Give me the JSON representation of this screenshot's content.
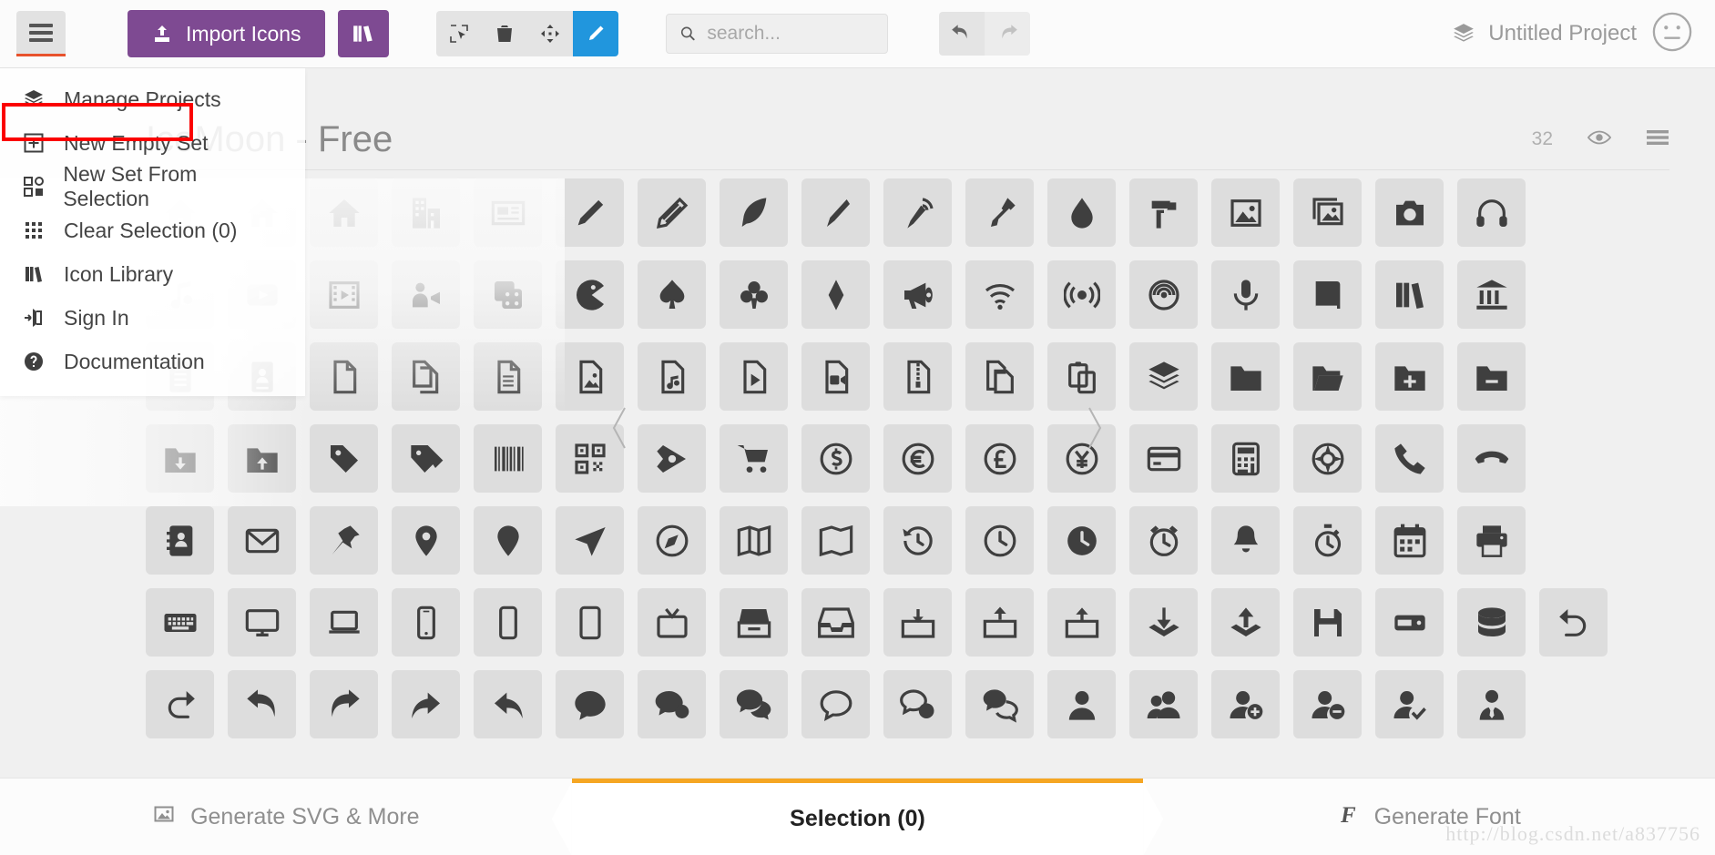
{
  "toolbar": {
    "menu_button_icon": "hamburger-icon",
    "import_label": "Import Icons",
    "import_icon": "upload-icon",
    "library_icon": "books-icon",
    "tools": [
      {
        "name": "select-tool",
        "icon": "cursor-select-icon",
        "active": false
      },
      {
        "name": "delete-tool",
        "icon": "trash-icon",
        "active": false
      },
      {
        "name": "move-tool",
        "icon": "move-arrows-icon",
        "active": false
      },
      {
        "name": "edit-tool",
        "icon": "pencil-icon",
        "active": true
      }
    ],
    "search": {
      "value": "",
      "placeholder": "search...",
      "icon": "search-icon"
    },
    "undo": {
      "icon": "undo-arrow-icon",
      "enabled": true
    },
    "redo": {
      "icon": "redo-arrow-icon",
      "enabled": false
    },
    "project_name": "Untitled Project",
    "project_icon": "stack-icon",
    "avatar_icon": "neutral-face-icon"
  },
  "menu": {
    "items": [
      {
        "label": "Manage Projects",
        "icon": "stack-icon",
        "highlighted": false
      },
      {
        "label": "New Empty Set",
        "icon": "plus-square-icon",
        "highlighted": true
      },
      {
        "label": "New Set From Selection",
        "icon": "new-set-icon",
        "highlighted": false
      },
      {
        "label": "Clear Selection (0)",
        "icon": "grid-dots-icon",
        "highlighted": false
      },
      {
        "label": "Icon Library",
        "icon": "books-icon",
        "highlighted": false
      },
      {
        "label": "Sign In",
        "icon": "sign-in-icon",
        "highlighted": false
      },
      {
        "label": "Documentation",
        "icon": "question-circle-icon",
        "highlighted": false
      }
    ],
    "highlight_color": "#fb0000"
  },
  "set": {
    "title": "IcoMoon - Free",
    "count": "32",
    "visibility_icon": "eye-icon",
    "menu_icon": "hamburger-icon"
  },
  "grid": {
    "rows": [
      [
        "home",
        "home2",
        "home3",
        "office",
        "newspaper",
        "pencil",
        "pencil2",
        "quill",
        "pen",
        "blog",
        "eyedropper",
        "droplet",
        "paint-format",
        "image",
        "images",
        "camera",
        "headphones"
      ],
      [
        "music",
        "play",
        "film",
        "video-camera",
        "dice",
        "pacman",
        "spades",
        "clubs",
        "diamonds",
        "bullhorn",
        "connection",
        "podcast",
        "feed",
        "mic",
        "book",
        "books",
        "library"
      ],
      [
        "file-text2",
        "profile",
        "file-empty",
        "files-empty",
        "file-text",
        "file-picture",
        "file-music",
        "file-play",
        "file-video",
        "file-zip",
        "copy",
        "paste",
        "stack",
        "folder",
        "folder-open",
        "folder-plus",
        "folder-minus"
      ],
      [
        "folder-download",
        "folder-upload",
        "price-tag",
        "price-tags",
        "barcode",
        "qrcode",
        "ticket",
        "cart",
        "coin-dollar",
        "coin-euro",
        "coin-pound",
        "coin-yen",
        "credit-card",
        "calculator",
        "lifebuoy",
        "phone",
        "phone-hang-up"
      ],
      [
        "address-book",
        "envelop",
        "pushpin",
        "location",
        "location2",
        "compass",
        "compass2",
        "map",
        "map2",
        "history",
        "clock",
        "clock2",
        "alarm",
        "bell",
        "stopwatch",
        "calendar",
        "printer"
      ],
      [
        "keyboard",
        "display",
        "laptop",
        "mobile",
        "mobile2",
        "tablet",
        "tv",
        "drawer",
        "drawer2",
        "drawer3",
        "box-add",
        "box-remove",
        "download",
        "upload",
        "floppy-disk",
        "drive",
        "database",
        "undo"
      ],
      [
        "redo",
        "undo2",
        "redo2",
        "forward",
        "reply",
        "bubble",
        "bubbles",
        "bubbles2",
        "bubble2",
        "bubbles3",
        "bubbles4",
        "user",
        "users",
        "user-plus",
        "user-minus",
        "user-check",
        "user-tie"
      ]
    ]
  },
  "bottom": {
    "tabs": [
      {
        "label": "Generate SVG & More",
        "icon": "image-icon",
        "active": false
      },
      {
        "label": "Selection (0)",
        "icon": "",
        "active": true
      },
      {
        "label": "Generate Font",
        "icon": "font-f-icon",
        "active": false
      }
    ],
    "active_color": "#f5a623"
  },
  "watermark": "http://blog.csdn.net/a837756",
  "colors": {
    "brand_purple": "#7e4a92",
    "accent_blue": "#2196dd",
    "accent_orange": "#f5a623",
    "highlight_red": "#fb0000",
    "page_bg": "#f0f0f0",
    "icon_cell_bg": "#dddddd"
  }
}
